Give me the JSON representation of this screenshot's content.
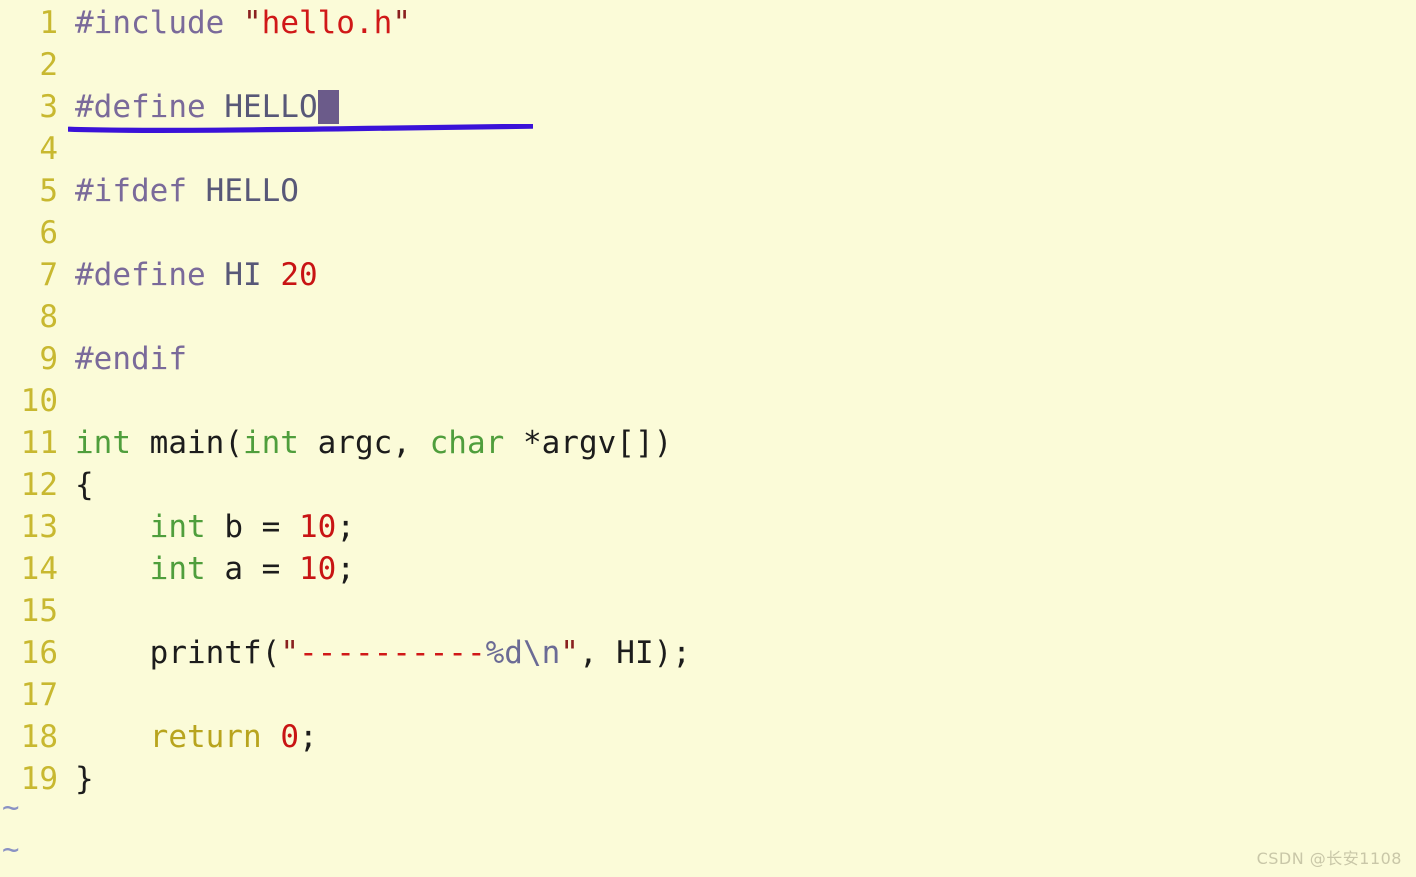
{
  "app": {
    "kind": "terminal-text-editor",
    "filetype": "c",
    "background_color": "#fbfbd8",
    "line_number_color": "#c8b830",
    "cursor_color": "#6b5b8a"
  },
  "gutter": {
    "numbers": [
      "1",
      "2",
      "3",
      "4",
      "5",
      "6",
      "7",
      "8",
      "9",
      "10",
      "11",
      "12",
      "13",
      "14",
      "15",
      "16",
      "17",
      "18",
      "19"
    ]
  },
  "lines": [
    {
      "n": "1",
      "text": "#include \"hello.h\""
    },
    {
      "n": "2",
      "text": ""
    },
    {
      "n": "3",
      "text": "#define HELLO"
    },
    {
      "n": "4",
      "text": ""
    },
    {
      "n": "5",
      "text": "#ifdef HELLO"
    },
    {
      "n": "6",
      "text": ""
    },
    {
      "n": "7",
      "text": "#define HI 20"
    },
    {
      "n": "8",
      "text": ""
    },
    {
      "n": "9",
      "text": "#endif"
    },
    {
      "n": "10",
      "text": ""
    },
    {
      "n": "11",
      "text": "int main(int argc, char *argv[])"
    },
    {
      "n": "12",
      "text": "{"
    },
    {
      "n": "13",
      "text": "    int b = 10;"
    },
    {
      "n": "14",
      "text": "    int a = 10;"
    },
    {
      "n": "15",
      "text": ""
    },
    {
      "n": "16",
      "text": "    printf(\"----------%d\\n\", HI);"
    },
    {
      "n": "17",
      "text": ""
    },
    {
      "n": "18",
      "text": "    return 0;"
    },
    {
      "n": "19",
      "text": "}"
    }
  ],
  "tokens": {
    "l1_pre": "#include ",
    "l1_q1": "\"",
    "l1_str": "hello.h",
    "l1_q2": "\"",
    "l3_pre": "#define ",
    "l3_ident": "HELLO",
    "l5_pre": "#ifdef ",
    "l5_ident": "HELLO",
    "l7_pre": "#define ",
    "l7_ident": "HI ",
    "l7_num": "20",
    "l9_pre": "#endif",
    "l11_type1": "int",
    "l11_mid1": " main(",
    "l11_type2": "int",
    "l11_mid2": " argc, ",
    "l11_type3": "char",
    "l11_mid3": " *argv[])",
    "l12_brace": "{",
    "l13_indent": "    ",
    "l13_type": "int",
    "l13_mid": " b = ",
    "l13_num": "10",
    "l13_end": ";",
    "l14_indent": "    ",
    "l14_type": "int",
    "l14_mid": " a = ",
    "l14_num": "10",
    "l14_end": ";",
    "l16_indent": "    ",
    "l16_fn": "printf(",
    "l16_q1": "\"",
    "l16_dashes": "----------",
    "l16_esc": "%d\\n",
    "l16_q2": "\"",
    "l16_tail": ", HI);",
    "l18_indent": "    ",
    "l18_kw": "return",
    "l18_sp": " ",
    "l18_num": "0",
    "l18_end": ";",
    "l19_brace": "}"
  },
  "empty_buffer_markers": [
    "~",
    "~"
  ],
  "annotation": {
    "type": "hand-drawn-underline",
    "color": "#3a12d8",
    "target_line": "3"
  },
  "watermark": {
    "text": "CSDN @长安1108"
  }
}
